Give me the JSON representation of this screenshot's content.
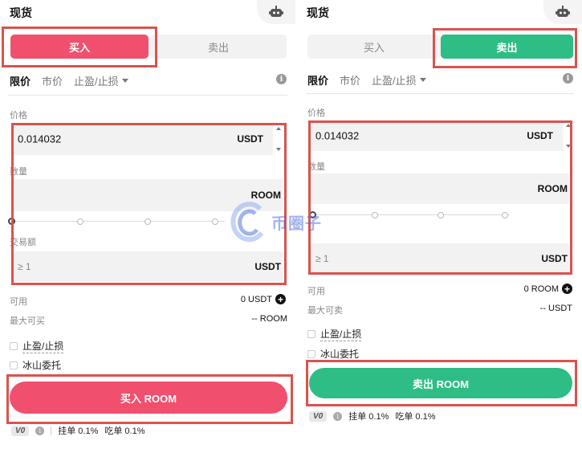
{
  "left": {
    "title": "现货",
    "buy_tab": "买入",
    "sell_tab": "卖出",
    "order_types": [
      "限价",
      "市价",
      "止盈/止损"
    ],
    "price_label": "价格",
    "price_value": "0.014032",
    "price_unit": "USDT",
    "qty_label": "数量",
    "qty_unit": "ROOM",
    "total_label": "交易额",
    "total_placeholder": "≥ 1",
    "total_unit": "USDT",
    "available_label": "可用",
    "available_value": "0 USDT",
    "max_label": "最大可买",
    "max_value": "-- ROOM",
    "tpsl_label": "止盈/止损",
    "iceberg_label": "冰山委托",
    "submit_label": "买入 ROOM",
    "vip_level": "V0",
    "maker_fee": "挂单 0.1%",
    "taker_fee": "吃单 0.1%"
  },
  "right": {
    "title": "现货",
    "buy_tab": "买入",
    "sell_tab": "卖出",
    "order_types": [
      "限价",
      "市价",
      "止盈/止损"
    ],
    "price_label": "价格",
    "price_value": "0.014032",
    "price_unit": "USDT",
    "qty_label": "数量",
    "qty_unit": "ROOM",
    "total_placeholder": "≥ 1",
    "total_unit": "USDT",
    "available_label": "可用",
    "available_value": "0 ROOM",
    "max_label": "最大可卖",
    "max_value": "-- USDT",
    "tpsl_label": "止盈/止损",
    "iceberg_label": "冰山委托",
    "submit_label": "卖出 ROOM",
    "vip_level": "V0",
    "maker_fee": "挂单 0.1%",
    "taker_fee": "吃单 0.1%"
  },
  "watermark": {
    "text": "币圈子"
  },
  "colors": {
    "buy": "#f0506e",
    "sell": "#2ebd85",
    "highlight": "#d9534f"
  },
  "icons": {
    "robot": "robot-icon",
    "info": "info-icon",
    "plus": "plus-circle-icon",
    "dropdown": "caret-down-icon"
  }
}
